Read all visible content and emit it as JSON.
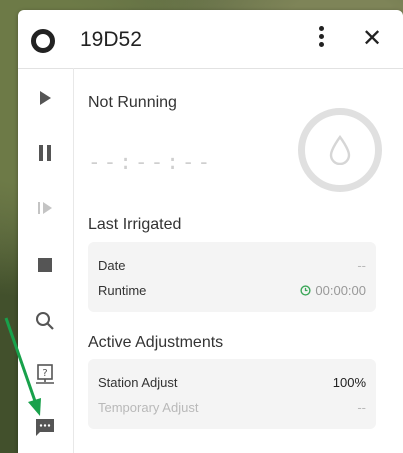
{
  "station": {
    "name": "19D52"
  },
  "status": {
    "label": "Not Running",
    "time": "--:--:--"
  },
  "last_irrigated": {
    "title": "Last Irrigated",
    "date_label": "Date",
    "date_value": "--",
    "runtime_label": "Runtime",
    "runtime_value": "00:00:00"
  },
  "adjustments": {
    "title": "Active Adjustments",
    "station_label": "Station Adjust",
    "station_value": "100%",
    "temporary_label": "Temporary Adjust",
    "temporary_value": "--"
  },
  "colors": {
    "runtime_accent": "#3aa657",
    "arrow": "#18a14b",
    "muted": "#b9b9b9"
  }
}
